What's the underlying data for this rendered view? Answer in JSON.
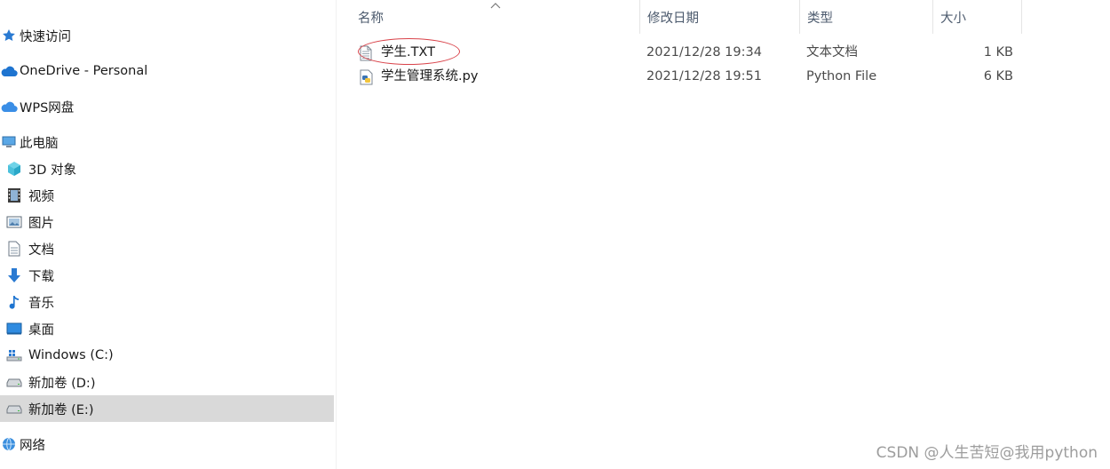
{
  "sidebar": {
    "items": [
      {
        "label": "快速访问",
        "icon": "star-icon"
      },
      {
        "label": "OneDrive - Personal",
        "icon": "cloud-icon"
      },
      {
        "label": "WPS网盘",
        "icon": "cloud-icon"
      },
      {
        "label": "此电脑",
        "icon": "computer-icon"
      },
      {
        "label": "3D 对象",
        "icon": "cube-icon"
      },
      {
        "label": "视频",
        "icon": "film-icon"
      },
      {
        "label": "图片",
        "icon": "picture-icon"
      },
      {
        "label": "文档",
        "icon": "document-icon"
      },
      {
        "label": "下载",
        "icon": "download-arrow-icon"
      },
      {
        "label": "音乐",
        "icon": "music-note-icon"
      },
      {
        "label": "桌面",
        "icon": "desktop-icon"
      },
      {
        "label": "Windows (C:)",
        "icon": "windows-drive-icon"
      },
      {
        "label": "新加卷 (D:)",
        "icon": "drive-icon"
      },
      {
        "label": "新加卷 (E:)",
        "icon": "drive-icon"
      },
      {
        "label": "网络",
        "icon": "network-icon"
      }
    ],
    "selected": "新加卷 (E:)"
  },
  "list": {
    "columns": {
      "name": "名称",
      "date": "修改日期",
      "type": "类型",
      "size": "大小"
    },
    "sorted_by": "name",
    "files": [
      {
        "name": "学生.TXT",
        "date": "2021/12/28 19:34",
        "type": "文本文档",
        "size": "1 KB",
        "icon": "text-file-icon"
      },
      {
        "name": "学生管理系统.py",
        "date": "2021/12/28 19:51",
        "type": "Python File",
        "size": "6 KB",
        "icon": "python-file-icon"
      }
    ]
  },
  "annotation": {
    "color": "#d9434a",
    "target": "学生.TXT"
  },
  "watermark": "CSDN @人生苦短@我用python",
  "colors": {
    "selected_bg": "#d9d9d9",
    "header_text": "#4d5b6e"
  }
}
